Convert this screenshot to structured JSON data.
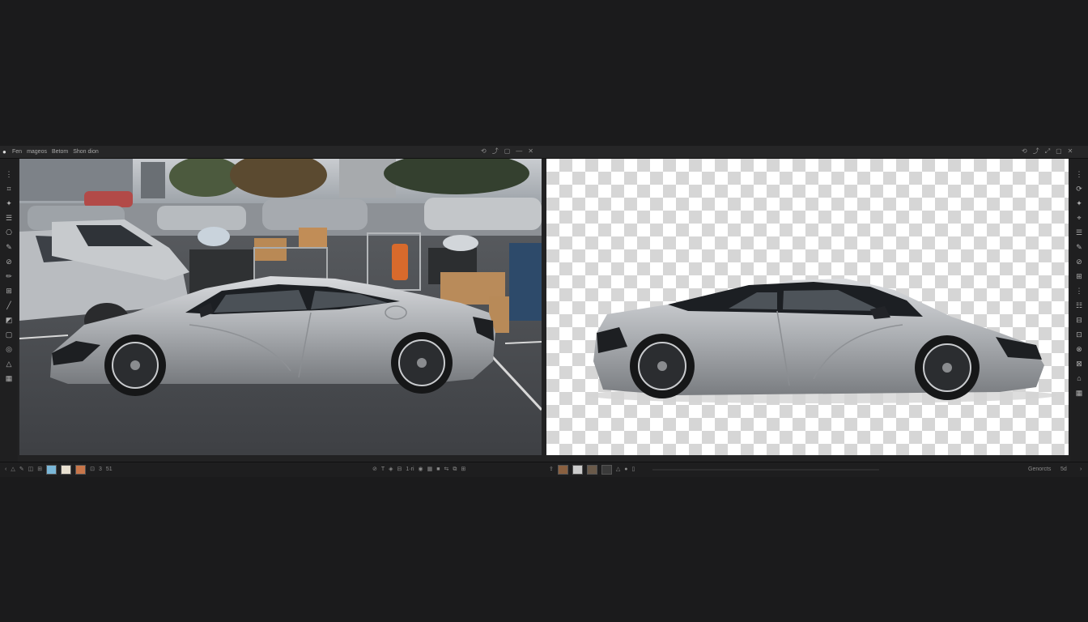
{
  "menu": {
    "logo_icon": "app-logo-icon",
    "items": [
      "Fen",
      "mageos",
      "Betom",
      "Shon dion"
    ]
  },
  "window_controls_left": [
    "⟲",
    "⤴",
    "▢",
    "—",
    "✕"
  ],
  "window_controls_right": [
    "⟲",
    "⤴",
    "⤢",
    "▢",
    "✕"
  ],
  "left_tools": [
    "⋮",
    "⌗",
    "✦",
    "☰",
    "⎔",
    "✎",
    "⊘",
    "✏",
    "⊞",
    "╱",
    "◩",
    "▢",
    "◎",
    "△",
    "▦"
  ],
  "right_tools": [
    "⋮",
    "⟳",
    "✦",
    "⌖",
    "☰",
    "✎",
    "⊘",
    "⊞",
    "⋮",
    "☷",
    "⊟",
    "⊡",
    "⊗",
    "⊠",
    "⌂",
    "▦"
  ],
  "bottom": {
    "left_text_a": "3",
    "left_text_b": "1·ri",
    "left_text_c": "51",
    "right_label": "Genorcts",
    "right_label_b": "5d",
    "thumb_colors": [
      "#7ab7d8",
      "#e8e0d0",
      "#c8764a",
      "#8a6040",
      "#cccccc",
      "#6a5a4a",
      "#3a3a3a"
    ]
  },
  "colors": {
    "app_bg": "#222223",
    "page_bg": "#1b1b1c",
    "car_body": "#b8babd"
  }
}
